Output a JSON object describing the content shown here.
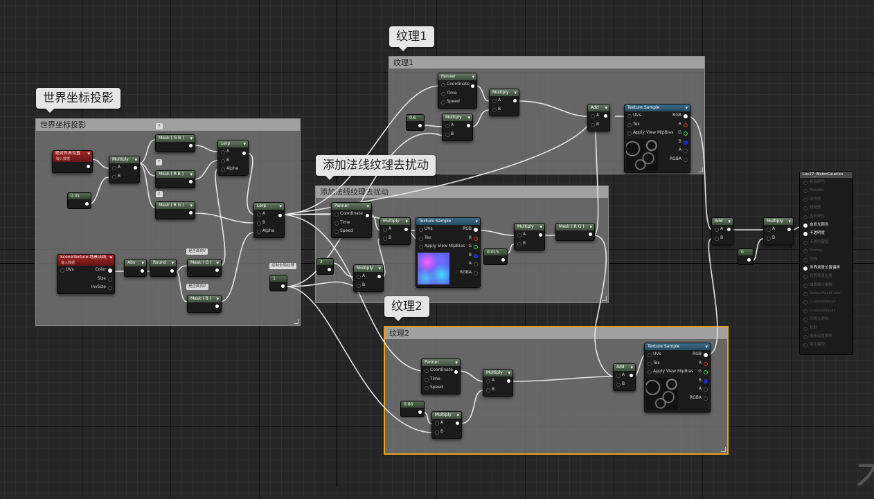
{
  "comments": {
    "world": "世界坐标投影",
    "tex1": "纹理1",
    "normal": "添加法线纹理去扰动",
    "tex2": "纹理2"
  },
  "bubbles": {
    "world": "世界坐标投影",
    "tex1": "纹理1",
    "normal": "添加法线纹理去扰动",
    "tex2": "纹理2"
  },
  "nodes": {
    "absWorldPos": {
      "title": "绝对世界位置",
      "sub": "输入数据"
    },
    "multiply": "Multiply",
    "lerp": "Lerp",
    "add": "Add",
    "panner": "Panner",
    "abs": "Abs",
    "round": "Round",
    "maskRB": "Mask ( R B )",
    "maskGB": "Mask ( G B )",
    "maskRG": "Mask ( R G )",
    "maskG": "Mask ( G )",
    "maskB": "Mask ( B )",
    "sceneTex": {
      "title": "SceneTexture:场景法线",
      "sub": "输入数据"
    },
    "textureSample": "Texture Sample",
    "pins": {
      "a": "A",
      "b": "B",
      "alpha": "Alpha",
      "coordinate": "Coordinate",
      "time": "Time",
      "speed": "Speed",
      "uvs": "UVs",
      "tex": "Tex",
      "applyViewMipBias": "Apply View MipBias",
      "rgb": "RGB",
      "r": "R",
      "g": "G",
      "bb": "B",
      "aa": "A",
      "rgba": "RGBA",
      "color": "Color",
      "size": "Size",
      "invSize": "InvSize"
    },
    "values": {
      "v001": "0.01",
      "v2": "2",
      "v1": "1",
      "v06": "0.6",
      "v0015": "0.015",
      "v066": "0.66",
      "v0": "0"
    },
    "tags": {
      "x": "X",
      "y": "Y",
      "z": "Z",
      "isY": "是否面向Y",
      "isZ": "是否面向Z",
      "globalTex": "控制全局纹理"
    }
  },
  "result": {
    "title": "Loc27_WaterCaustics",
    "items": [
      {
        "label": "基础颜色",
        "on": false
      },
      {
        "label": "Metallic",
        "on": false
      },
      {
        "label": "高光度",
        "on": false
      },
      {
        "label": "粗糙度",
        "on": false
      },
      {
        "label": "各向异性",
        "on": false
      },
      {
        "label": "自发光颜色",
        "on": true
      },
      {
        "label": "不透明度",
        "on": true
      },
      {
        "label": "不透明蒙版",
        "on": false
      },
      {
        "label": "Normal",
        "on": false
      },
      {
        "label": "切线",
        "on": false
      },
      {
        "label": "世界场景位置偏移",
        "on": true
      },
      {
        "label": "世界场景位移",
        "on": false
      },
      {
        "label": "曲面细分乘数",
        "on": false
      },
      {
        "label": "SubsurfaceColor",
        "on": false
      },
      {
        "label": "CustomData0",
        "on": false
      },
      {
        "label": "CustomData1",
        "on": false
      },
      {
        "label": "环境光遮挡",
        "on": false
      },
      {
        "label": "折射",
        "on": false
      },
      {
        "label": "像素深度偏移",
        "on": false
      },
      {
        "label": "着色模型",
        "on": false
      }
    ]
  },
  "watermark": "木"
}
